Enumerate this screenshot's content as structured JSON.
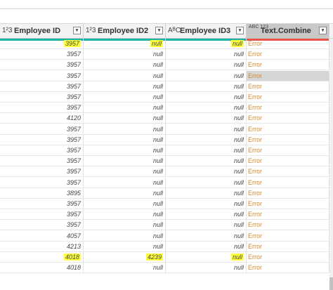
{
  "columns": [
    {
      "type": "1²3",
      "title": "Employee ID",
      "quality_color": "#14b5a8"
    },
    {
      "type": "1²3",
      "title": "Employee ID2",
      "quality_color": "#14b5a8"
    },
    {
      "type": "AᴮC",
      "title": "Employee ID3",
      "quality_color": "#14b5a8"
    },
    {
      "type": "ABC 123",
      "title": "Text.Combine",
      "quality_color": "#e8534a"
    }
  ],
  "rows": [
    {
      "id": "3957",
      "id2": "null",
      "id3": "null",
      "combine": "Error"
    },
    {
      "id": "3957",
      "id2": "null",
      "id3": "null",
      "combine": "Error"
    },
    {
      "id": "3957",
      "id2": "null",
      "id3": "null",
      "combine": "Error"
    },
    {
      "id": "3957",
      "id2": "null",
      "id3": "null",
      "combine": "Error"
    },
    {
      "id": "3957",
      "id2": "null",
      "id3": "null",
      "combine": "Error"
    },
    {
      "id": "3957",
      "id2": "null",
      "id3": "null",
      "combine": "Error"
    },
    {
      "id": "3957",
      "id2": "null",
      "id3": "null",
      "combine": "Error"
    },
    {
      "id": "4120",
      "id2": "null",
      "id3": "null",
      "combine": "Error"
    },
    {
      "id": "3957",
      "id2": "null",
      "id3": "null",
      "combine": "Error"
    },
    {
      "id": "3957",
      "id2": "null",
      "id3": "null",
      "combine": "Error"
    },
    {
      "id": "3957",
      "id2": "null",
      "id3": "null",
      "combine": "Error"
    },
    {
      "id": "3957",
      "id2": "null",
      "id3": "null",
      "combine": "Error"
    },
    {
      "id": "3957",
      "id2": "null",
      "id3": "null",
      "combine": "Error"
    },
    {
      "id": "3957",
      "id2": "null",
      "id3": "null",
      "combine": "Error"
    },
    {
      "id": "3895",
      "id2": "null",
      "id3": "null",
      "combine": "Error"
    },
    {
      "id": "3957",
      "id2": "null",
      "id3": "null",
      "combine": "Error"
    },
    {
      "id": "3957",
      "id2": "null",
      "id3": "null",
      "combine": "Error"
    },
    {
      "id": "3957",
      "id2": "null",
      "id3": "null",
      "combine": "Error"
    },
    {
      "id": "4057",
      "id2": "null",
      "id3": "null",
      "combine": "Error"
    },
    {
      "id": "4213",
      "id2": "null",
      "id3": "null",
      "combine": "Error"
    },
    {
      "id": "4018",
      "id2": "4239",
      "id3": "null",
      "combine": "Error"
    },
    {
      "id": "4018",
      "id2": "null",
      "id3": "null",
      "combine": "Error"
    }
  ],
  "highlight_color": "#ffff3a",
  "error_color": "#d4882c"
}
